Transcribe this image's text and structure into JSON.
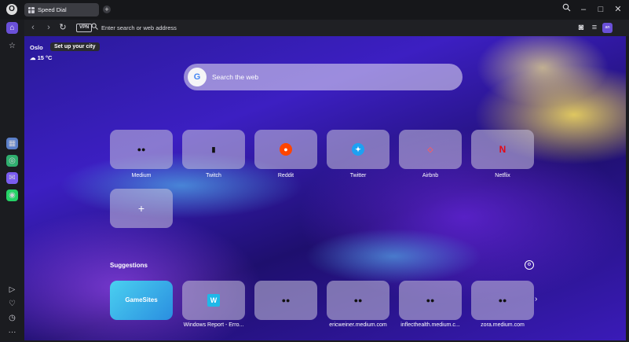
{
  "tab": {
    "title": "Speed Dial"
  },
  "toolbar": {
    "vpn": "VPN",
    "address_placeholder": "Enter search or web address",
    "avatar": "an"
  },
  "weather": {
    "city": "Oslo",
    "temperature": "15 °C",
    "tooltip": "Set up your city"
  },
  "search": {
    "placeholder": "Search the web",
    "engine_icon": "G"
  },
  "speed_dial": [
    {
      "label": "Medium",
      "icon": "●●"
    },
    {
      "label": "Twitch",
      "icon": "▮"
    },
    {
      "label": "Reddit",
      "icon": "●"
    },
    {
      "label": "Twitter",
      "icon": "✦"
    },
    {
      "label": "Airbnb",
      "icon": "◇"
    },
    {
      "label": "Netflix",
      "icon": "N"
    }
  ],
  "add_tile": "+",
  "suggestions": {
    "title": "Suggestions",
    "items": [
      {
        "label": "",
        "icon": "GameSites"
      },
      {
        "label": "Windows Report - Erro...",
        "icon": "W"
      },
      {
        "label": "",
        "icon": "●●"
      },
      {
        "label": "ericweiner.medium.com",
        "icon": "●●"
      },
      {
        "label": "inflecthealth.medium.c...",
        "icon": "●●"
      },
      {
        "label": "zora.medium.com",
        "icon": "●●"
      }
    ]
  },
  "colors": {
    "accent": "#6a50d8",
    "netflix": "#e50914",
    "reddit": "#ff4500",
    "twitter": "#1da1f2",
    "airbnb": "#ff5a5f",
    "twitch": "#9146ff"
  }
}
